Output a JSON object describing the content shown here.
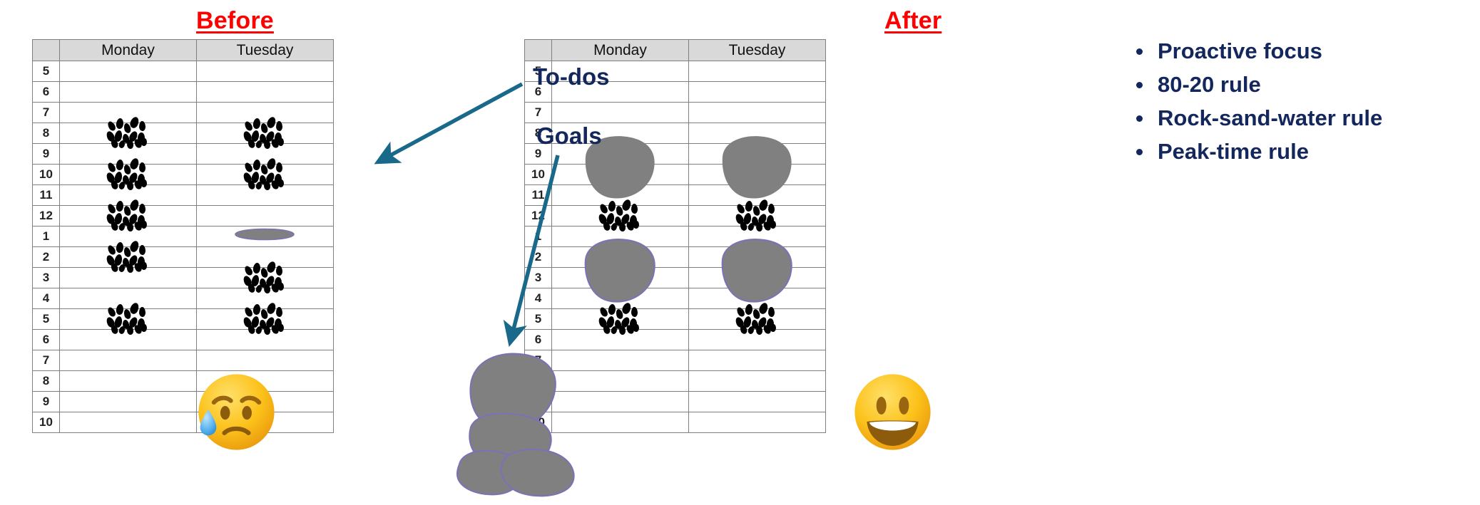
{
  "headings": {
    "before": "Before",
    "after": "After",
    "title_color": "#ff0000"
  },
  "callouts": {
    "todos": "To-dos",
    "goals": "Goals",
    "arrow_color": "#19698a",
    "text_color": "#13275c"
  },
  "legend_bullets": [
    "Proactive focus",
    "80-20 rule",
    "Rock-sand-water rule",
    "Peak-time rule"
  ],
  "schedule": {
    "columns": [
      "",
      "Monday",
      "Tuesday"
    ],
    "hours": [
      "5",
      "6",
      "7",
      "8",
      "9",
      "10",
      "11",
      "12",
      "1",
      "2",
      "3",
      "4",
      "5",
      "6",
      "7",
      "8",
      "9",
      "10"
    ],
    "header_bg": "#d9d9d9",
    "grid_color": "#7f7f7f"
  },
  "before_table": {
    "monday_sand_hours": [
      "8",
      "10",
      "12",
      "2",
      "5"
    ],
    "tuesday_sand_hours": [
      "8",
      "10",
      "3",
      "5"
    ],
    "tuesday_water_hours": [
      "1"
    ],
    "monday_rock_hours": [],
    "tuesday_rock_hours": [],
    "mood": "sad-sweat-face"
  },
  "after_table": {
    "monday_rock_hours": [
      "9",
      "2"
    ],
    "tuesday_rock_hours": [
      "9",
      "2"
    ],
    "monday_sand_hours": [
      "12",
      "5"
    ],
    "tuesday_sand_hours": [
      "12",
      "5"
    ],
    "mood": "grinning-face"
  },
  "goals_rock_pile": {
    "label": "rock-pile",
    "rock_count": 4,
    "fill": "#808080",
    "stroke": "#7a73b3"
  },
  "colors": {
    "sand": "#000000",
    "rock_fill": "#808080",
    "rock_stroke": "#7a73b3",
    "emoji_yellow": "#fcc21b",
    "emoji_tear": "#4aabe8"
  }
}
